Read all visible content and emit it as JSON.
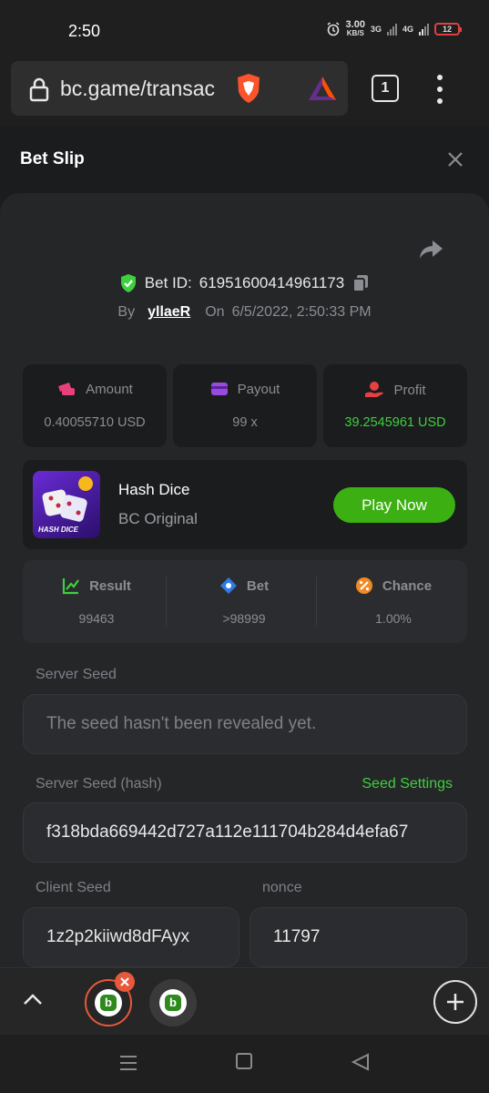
{
  "status_bar": {
    "time": "2:50",
    "net_speed_value": "3.00",
    "net_speed_unit": "KB/S",
    "signal_1": "3G",
    "signal_2": "4G",
    "battery": "12"
  },
  "browser": {
    "url": "bc.game/transac",
    "tab_count": "1"
  },
  "bet_slip": {
    "title": "Bet Slip",
    "bet_id_label": "Bet ID:",
    "bet_id": "61951600414961173",
    "by_label": "By",
    "user": "yllaeR",
    "on_label": "On",
    "date": "6/5/2022, 2:50:33 PM",
    "stats": {
      "amount_label": "Amount",
      "amount_value": "0.40055710 USD",
      "payout_label": "Payout",
      "payout_value": "99 x",
      "profit_label": "Profit",
      "profit_value": "39.2545961 USD"
    },
    "game": {
      "thumb_text": "HASH DICE",
      "name": "Hash Dice",
      "subtitle": "BC Original",
      "play_label": "Play Now"
    },
    "results": {
      "result_label": "Result",
      "result_value": "99463",
      "bet_label": "Bet",
      "bet_value": ">98999",
      "chance_label": "Chance",
      "chance_value": "1.00%"
    },
    "server_seed_label": "Server Seed",
    "server_seed_value": "The seed hasn't been revealed yet.",
    "server_hash_label": "Server Seed (hash)",
    "seed_settings_label": "Seed Settings",
    "server_hash_value": "f318bda669442d727a112e111704b284d4efa67",
    "client_seed_label": "Client Seed",
    "client_seed_value": "1z2p2kiiwd8dFAyx",
    "nonce_label": "nonce",
    "nonce_value": "11797"
  },
  "colors": {
    "accent_green": "#3cb012",
    "profit_green": "#3ecf3e",
    "tab_ring": "#e8583a"
  }
}
